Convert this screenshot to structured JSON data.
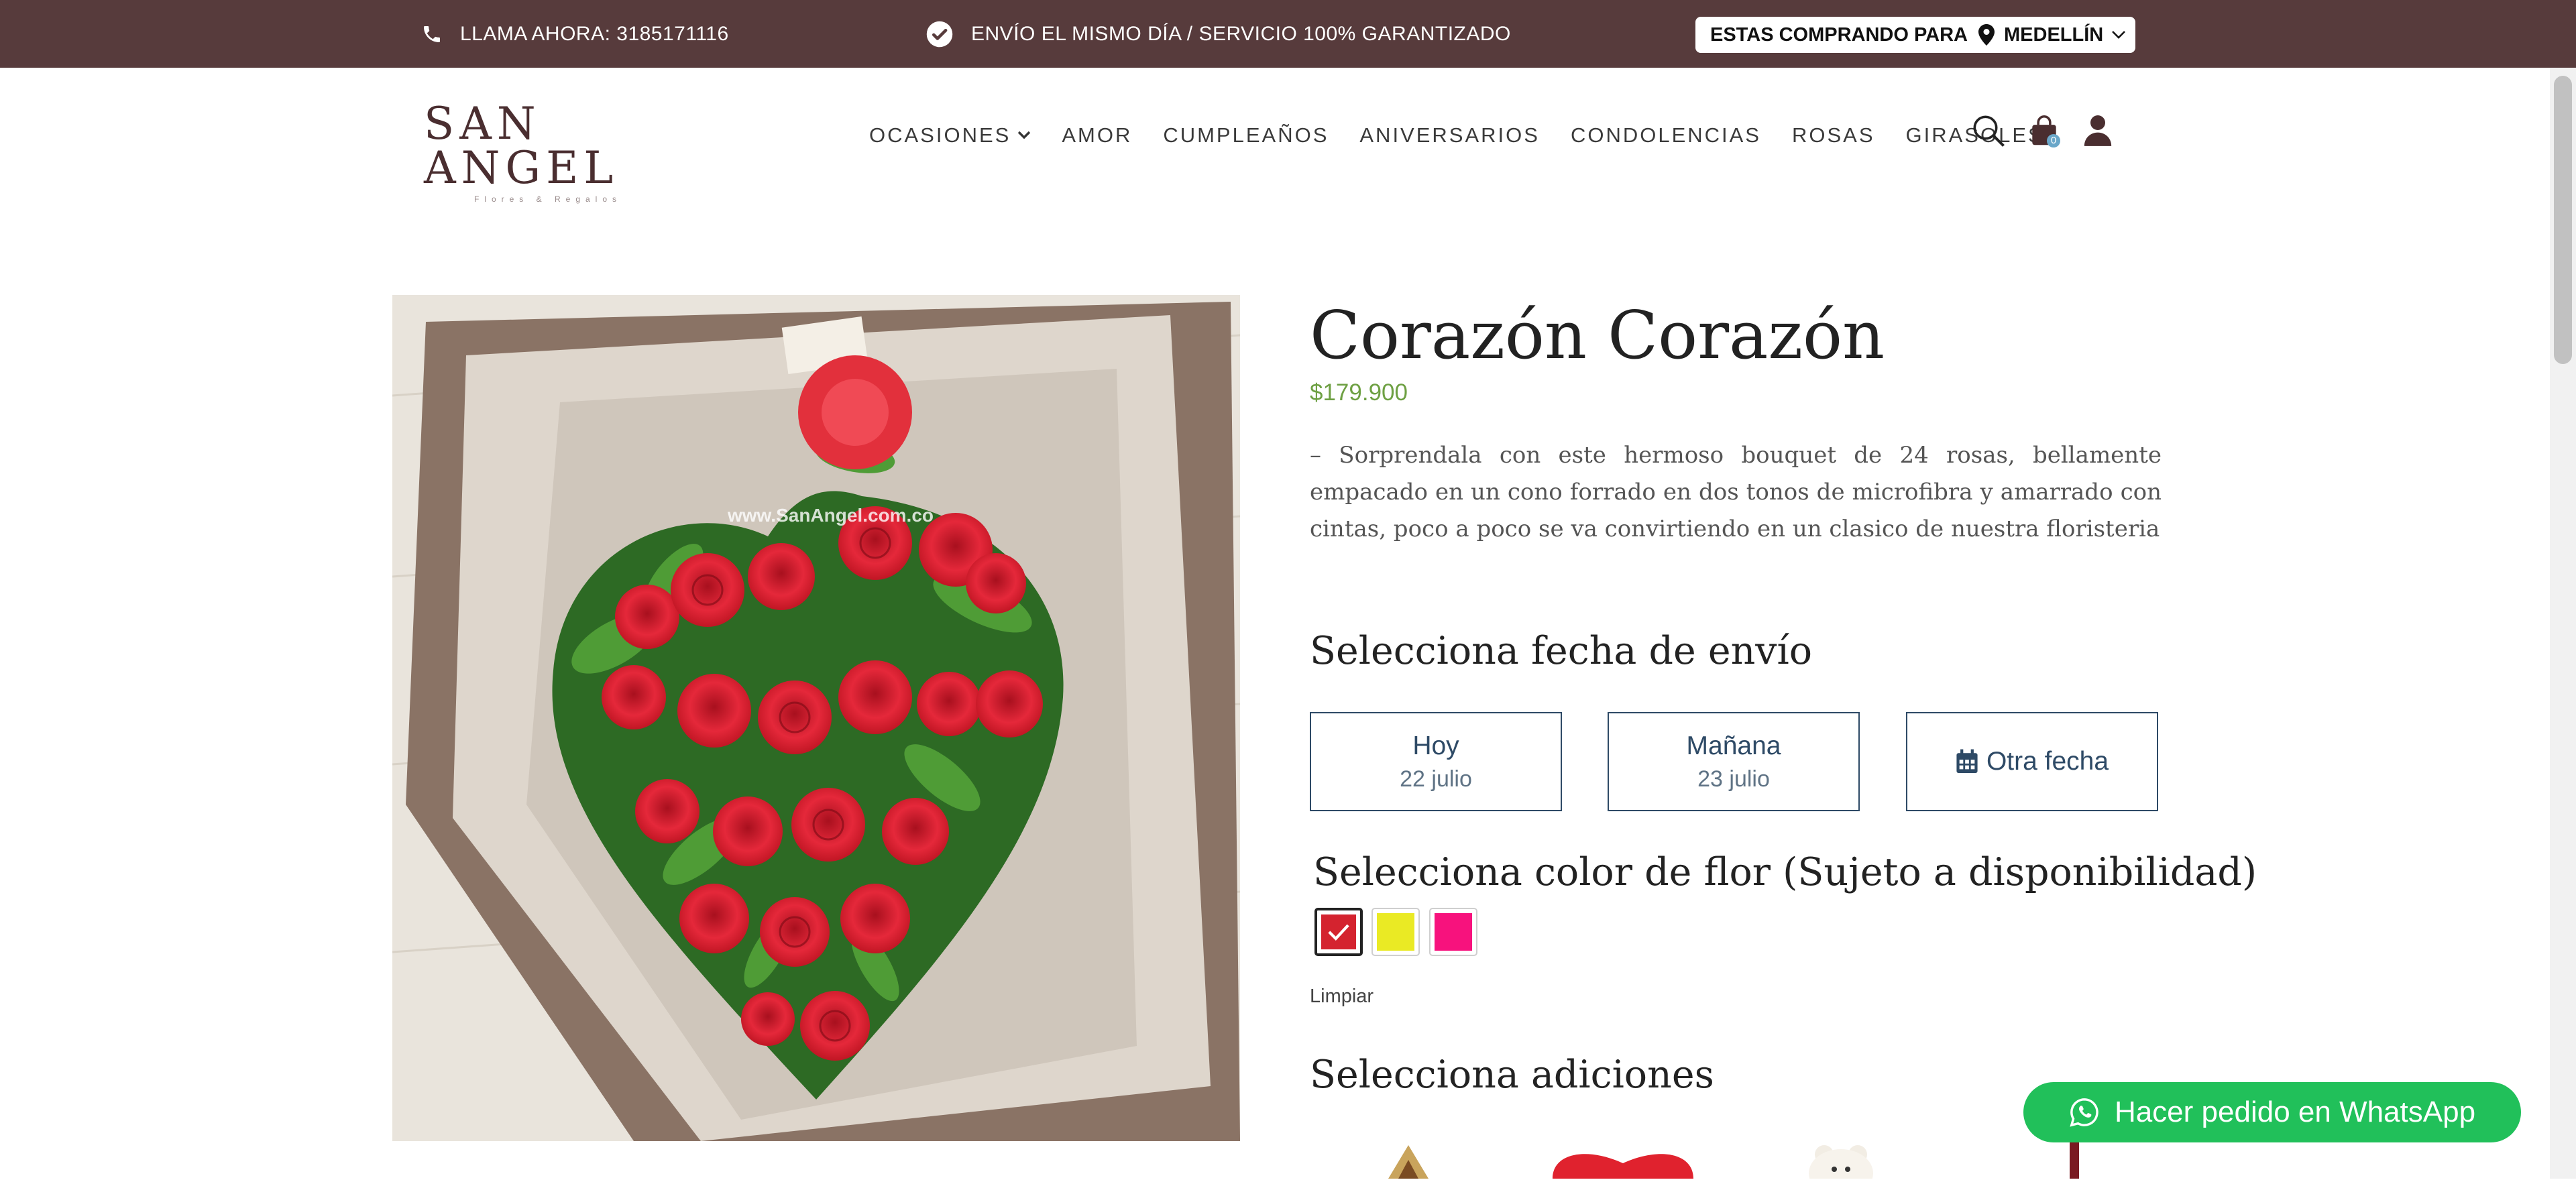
{
  "topbar": {
    "phone_text": "LLAMA AHORA: 3185171116",
    "shipping_text": "ENVÍO EL MISMO DÍA / SERVICIO 100% GARANTIZADO",
    "city_prefix": "ESTAS COMPRANDO PARA",
    "city": "MEDELLÍN"
  },
  "logo": {
    "main": "SAN ANGEL",
    "sub": "Flores & Regalos"
  },
  "nav": {
    "items": [
      {
        "label": "OCASIONES"
      },
      {
        "label": "AMOR"
      },
      {
        "label": "CUMPLEAÑOS"
      },
      {
        "label": "ANIVERSARIOS"
      },
      {
        "label": "CONDOLENCIAS"
      },
      {
        "label": "ROSAS"
      },
      {
        "label": "GIRASOLES"
      }
    ],
    "cart_count": "0"
  },
  "product": {
    "title": "Corazón Corazón",
    "price": "$179.900",
    "description": "– Sorprendala con este hermoso bouquet de 24 rosas, bellamente empacado en un cono forrado en dos tonos de microfibra y amarrado con cintas, poco a poco se va convirtiendo en un clasico de nuestra floristeria",
    "watermark": "www.SanAngel.com.co"
  },
  "shipping_date": {
    "title": "Selecciona fecha de envío",
    "options": [
      {
        "main": "Hoy",
        "sub": "22 julio"
      },
      {
        "main": "Mañana",
        "sub": "23 julio"
      },
      {
        "main": "Otra fecha"
      }
    ]
  },
  "flower_color": {
    "title": "Selecciona color de flor (Sujeto a disponibilidad)",
    "swatches": [
      {
        "color": "#d4232f",
        "selected": true
      },
      {
        "color": "#eaea24",
        "selected": false
      },
      {
        "color": "#f7127d",
        "selected": false
      }
    ],
    "clear_label": "Limpiar"
  },
  "additions": {
    "title": "Selecciona adiciones"
  },
  "whatsapp": {
    "label": "Hacer pedido en WhatsApp"
  },
  "colors": {
    "topbar_bg": "#573b3c",
    "price": "#6ea043",
    "date_border": "#2e4a66",
    "whatsapp": "#21c05a"
  }
}
